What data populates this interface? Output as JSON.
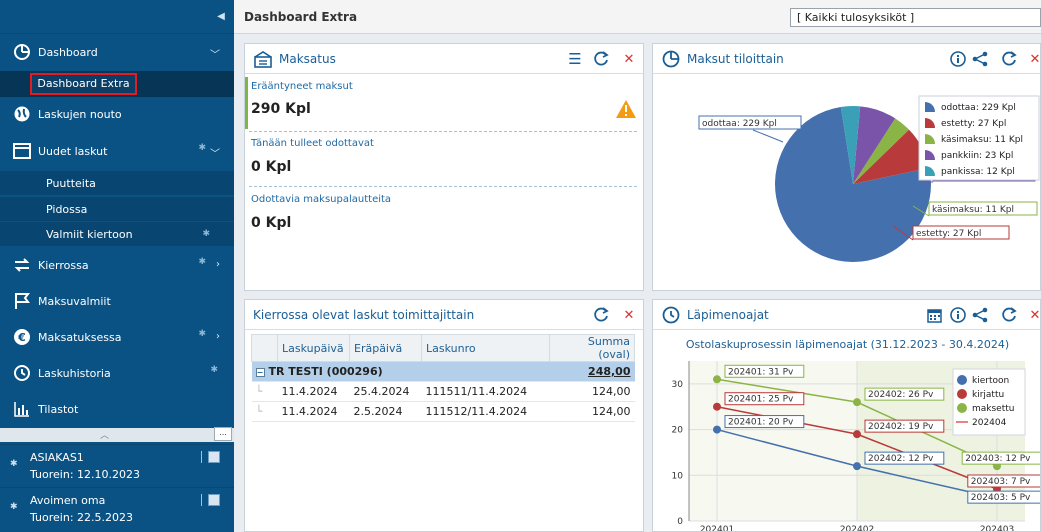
{
  "sidebar": {
    "items": [
      {
        "label": "Dashboard",
        "icon": "pie-chart-icon"
      },
      {
        "label": "Laskujen nouto",
        "icon": "globe-icon"
      },
      {
        "label": "Uudet laskut",
        "icon": "window-icon"
      },
      {
        "label": "Kierrossa",
        "icon": "swap-arrows-icon"
      },
      {
        "label": "Maksuvalmiit",
        "icon": "flag-icon"
      },
      {
        "label": "Maksatuksessa",
        "icon": "euro-icon"
      },
      {
        "label": "Laskuhistoria",
        "icon": "history-icon"
      },
      {
        "label": "Tilastot",
        "icon": "bar-chart-icon"
      }
    ],
    "active_sub": "Dashboard Extra",
    "uudet_sub": [
      "Puutteita",
      "Pidossa",
      "Valmiit kiertoon"
    ],
    "cards": [
      {
        "name": "ASIAKAS1",
        "date": "Tuorein: 12.10.2023"
      },
      {
        "name": "Avoimen oma",
        "date": "Tuorein: 22.5.2023"
      }
    ],
    "more_label": "..."
  },
  "topbar": {
    "title": "Dashboard Extra",
    "select_value": "[ Kaikki tulosyksiköt ]"
  },
  "maksatus": {
    "title": "Maksatus",
    "rows": [
      {
        "label": "Erääntyneet maksut",
        "value": "290  Kpl"
      },
      {
        "label": "Tänään tulleet odottavat",
        "value": "0  Kpl"
      },
      {
        "label": "Odottavia maksupalautteita",
        "value": "0  Kpl"
      }
    ]
  },
  "tilat": {
    "title": "Maksut tiloittain"
  },
  "kierrossa": {
    "title": "Kierrossa olevat laskut toimittajittain",
    "columns": [
      "Laskupäivä",
      "Eräpäivä",
      "Laskunro",
      "Summa (oval)"
    ],
    "group": {
      "name": "TR TESTI (000296)",
      "sum": "248,00"
    },
    "rows": [
      {
        "laskupaiva": "11.4.2024",
        "erapaiva": "25.4.2024",
        "laskunro": "111511/11.4.2024",
        "summa": "124,00"
      },
      {
        "laskupaiva": "11.4.2024",
        "erapaiva": "2.5.2024",
        "laskunro": "111512/11.4.2024",
        "summa": "124,00"
      }
    ]
  },
  "lapi": {
    "title": "Läpimenoajat"
  },
  "colors": {
    "sidebar_bg": "#0b5284",
    "accent": "#1a5e95",
    "close_red": "#d9322b",
    "warning": "#f39c12",
    "active_border": "#e31b23"
  },
  "chart_data": [
    {
      "type": "pie",
      "labels": [
        "odottaa",
        "estetty",
        "käsimaksu",
        "pankkiin",
        "pankissa"
      ],
      "values": [
        229,
        27,
        11,
        23,
        12
      ],
      "colors": [
        "#4470ad",
        "#b83a3a",
        "#8ab446",
        "#7a54a8",
        "#3aa0b8"
      ],
      "legend": [
        "odottaa: 229 Kpl",
        "estetty: 27 Kpl",
        "käsimaksu: 11 Kpl",
        "pankkiin: 23 Kpl",
        "pankissa: 12 Kpl"
      ],
      "slice_labels": [
        "odottaa: 229 Kpl",
        "estetty: 27 Kpl",
        "käsimaksu: 11 Kpl",
        "pankkiin: 23 Kpl",
        ""
      ],
      "legend_position": "top-right"
    },
    {
      "type": "line",
      "title": "Ostolaskuprosessin läpimenoajat (31.12.2023 - 30.4.2024)",
      "categories": [
        "202401",
        "202402",
        "202403"
      ],
      "ylim": [
        0,
        35
      ],
      "yticks": [
        0,
        10,
        20,
        30
      ],
      "series": [
        {
          "name": "kiertoon",
          "values": [
            20,
            12,
            5
          ],
          "color": "#4470ad",
          "labels": [
            "202401: 20 Pv",
            "202402: 12 Pv",
            "202403: 5 Pv"
          ]
        },
        {
          "name": "kirjattu",
          "values": [
            25,
            19,
            7
          ],
          "color": "#b83a3a",
          "labels": [
            "202401: 25 Pv",
            "202402: 19 Pv",
            "202403: 7 Pv"
          ]
        },
        {
          "name": "maksettu",
          "values": [
            31,
            26,
            12
          ],
          "color": "#8ab446",
          "labels": [
            "202401: 31 Pv",
            "202402: 26 Pv",
            "202403: 12 Pv"
          ]
        }
      ],
      "extra_legend": "202404",
      "legend_position": "right",
      "grid": true
    }
  ]
}
